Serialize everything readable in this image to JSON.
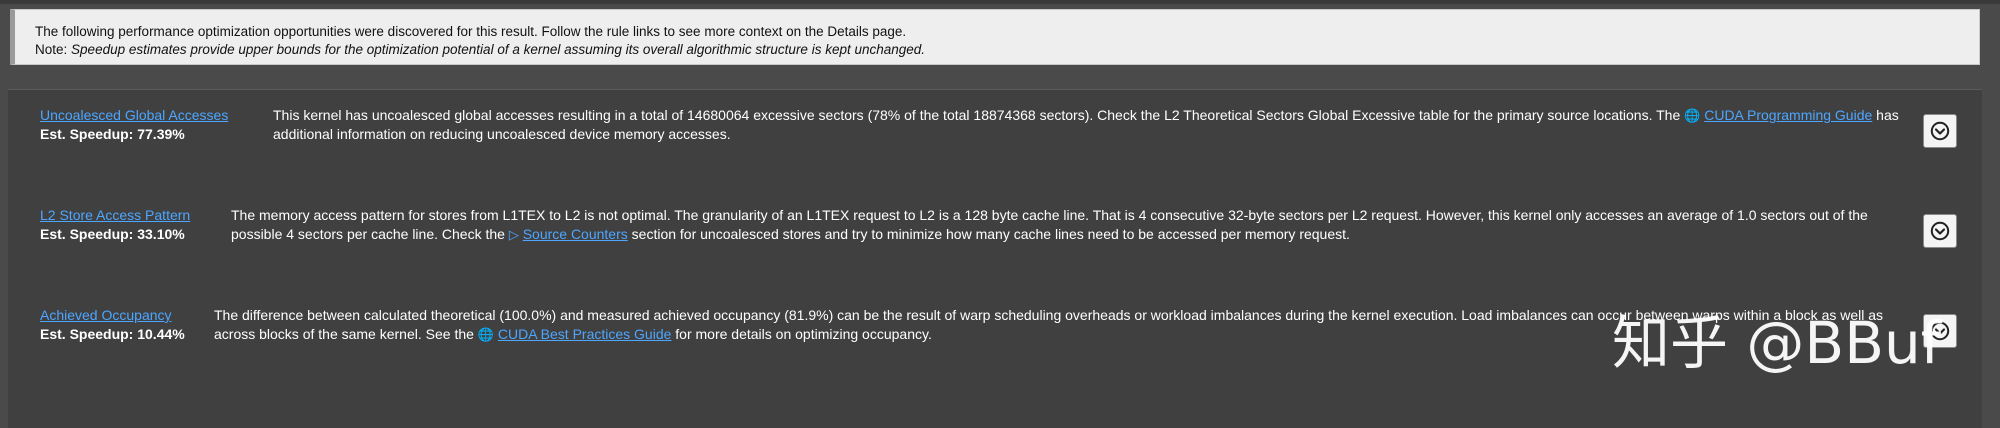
{
  "notice": {
    "line1": "The following performance optimization opportunities were discovered for this result. Follow the rule links to see more context on the Details page.",
    "note_label": "Note:",
    "note_text": "Speedup estimates provide upper bounds for the optimization potential of a kernel assuming its overall algorithmic structure is kept unchanged."
  },
  "rules": [
    {
      "name": "Uncoalesced Global Accesses",
      "speedup": "Est. Speedup: 77.39%",
      "desc_before": "This kernel has uncoalesced global accesses resulting in a total of 14680064 excessive sectors (78% of the total 18874368 sectors). Check the L2 Theoretical Sectors Global Excessive table for the primary source locations. The ",
      "link_icon": "globe-icon",
      "link_text": "CUDA Programming Guide",
      "desc_after": " has additional information on reducing uncoalesced device memory accesses."
    },
    {
      "name": "L2 Store Access Pattern",
      "speedup": "Est. Speedup: 33.10%",
      "desc_before": "The memory access pattern for stores from L1TEX to L2 is not optimal. The granularity of an L1TEX request to L2 is a 128 byte cache line. That is 4 consecutive 32-byte sectors per L2 request. However, this kernel only accesses an average of 1.0 sectors out of the possible 4 sectors per cache line. Check the ",
      "link_icon": "arrow-icon",
      "link_text": "Source Counters",
      "desc_after": " section for uncoalesced stores and try to minimize how many cache lines need to be accessed per memory request."
    },
    {
      "name": "Achieved Occupancy",
      "speedup": "Est. Speedup: 10.44%",
      "desc_before": "The difference between calculated theoretical (100.0%) and measured achieved occupancy (81.9%) can be the result of warp scheduling overheads or workload imbalances during the kernel execution. Load imbalances can occur between warps within a block as well as across blocks of the same kernel. See the ",
      "link_icon": "globe-icon",
      "link_text": "CUDA Best Practices Guide",
      "desc_after": " for more details on optimizing occupancy."
    }
  ],
  "icons": {
    "expand": "chevron-down-circle-icon",
    "globe": "globe-icon",
    "arrow": "arrow-icon"
  },
  "watermark": "知乎 @BBuf",
  "colors": {
    "background": "#4a4a4a",
    "panel": "#404040",
    "notice_bg": "#eeeeee",
    "link": "#4da6ff",
    "text": "#ffffff"
  }
}
